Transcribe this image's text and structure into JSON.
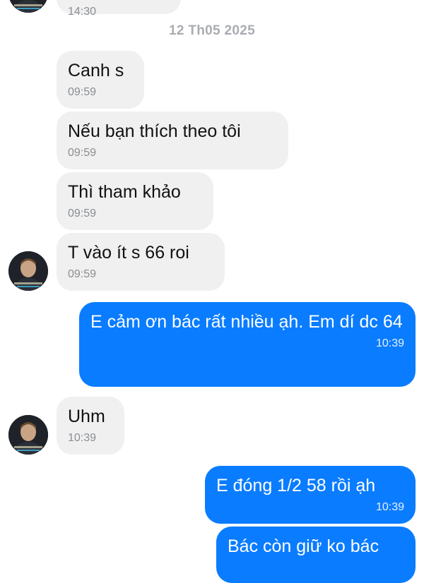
{
  "date_separator": "12 Th05 2025",
  "messages": [
    {
      "side": "in",
      "text": "",
      "time": "14:30"
    },
    {
      "side": "in",
      "text": "Canh s",
      "time": "09:59"
    },
    {
      "side": "in",
      "text": "Nếu bạn thích theo tôi",
      "time": "09:59"
    },
    {
      "side": "in",
      "text": "Thì tham khảo",
      "time": "09:59"
    },
    {
      "side": "in",
      "text": "T vào ít s 66 roi",
      "time": "09:59"
    },
    {
      "side": "out",
      "text": "E cảm ơn bác rất nhiều ạh. Em dí dc 64",
      "time": "10:39"
    },
    {
      "side": "in",
      "text": "Uhm",
      "time": "10:39"
    },
    {
      "side": "out",
      "text": "E đóng 1/2 58 rồi ạh",
      "time": "10:39"
    },
    {
      "side": "out",
      "text": "Bác còn giữ ko bác",
      "time": ""
    }
  ],
  "colors": {
    "outgoing_bubble": "#0a7cff",
    "incoming_bubble": "#f0f0f0",
    "date_text": "#a9acb1",
    "time_incoming": "#8a8d91"
  },
  "icons": {
    "avatar": "profile-photo-icon"
  }
}
